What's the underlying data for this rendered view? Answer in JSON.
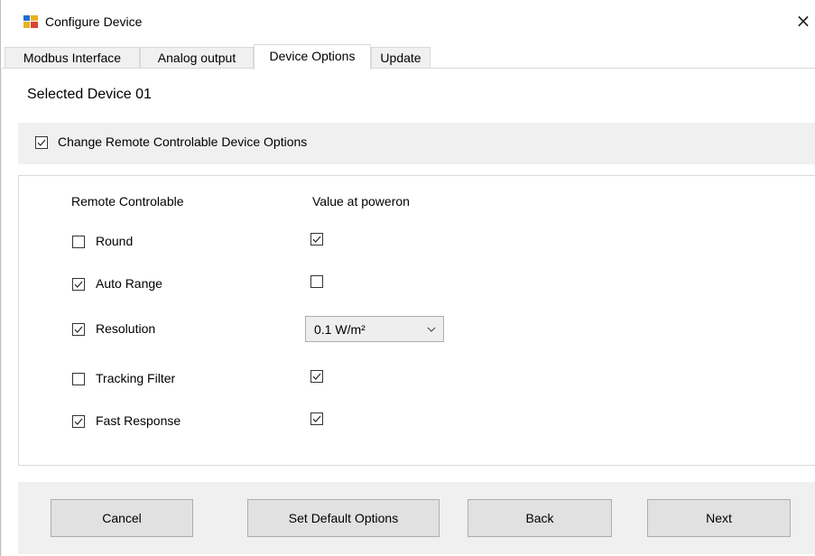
{
  "window": {
    "title": "Configure Device",
    "close_glyph": "×"
  },
  "tabs": [
    {
      "label": "Modbus Interface",
      "active": false
    },
    {
      "label": "Analog output",
      "active": false
    },
    {
      "label": "Device Options",
      "active": true
    },
    {
      "label": "Update",
      "active": false
    }
  ],
  "selected_device": "Selected Device 01",
  "change_remote": {
    "label": "Change Remote Controlable Device Options",
    "checked": true
  },
  "columns": {
    "remote": "Remote Controlable",
    "value": "Value at poweron"
  },
  "options": [
    {
      "label": "Round",
      "remote_checked": false,
      "value_checked": true
    },
    {
      "label": "Auto Range",
      "remote_checked": true,
      "value_checked": false
    },
    {
      "label": "Resolution",
      "remote_checked": true,
      "dropdown_value": "0.1 W/m²"
    },
    {
      "label": "Tracking Filter",
      "remote_checked": false,
      "value_checked": true
    },
    {
      "label": "Fast Response",
      "remote_checked": true,
      "value_checked": true
    }
  ],
  "buttons": {
    "cancel": "Cancel",
    "set_default": "Set Default Options",
    "back": "Back",
    "next": "Next"
  },
  "colors": {
    "background": "#f0f0f0",
    "button_face": "#e1e1e1"
  }
}
